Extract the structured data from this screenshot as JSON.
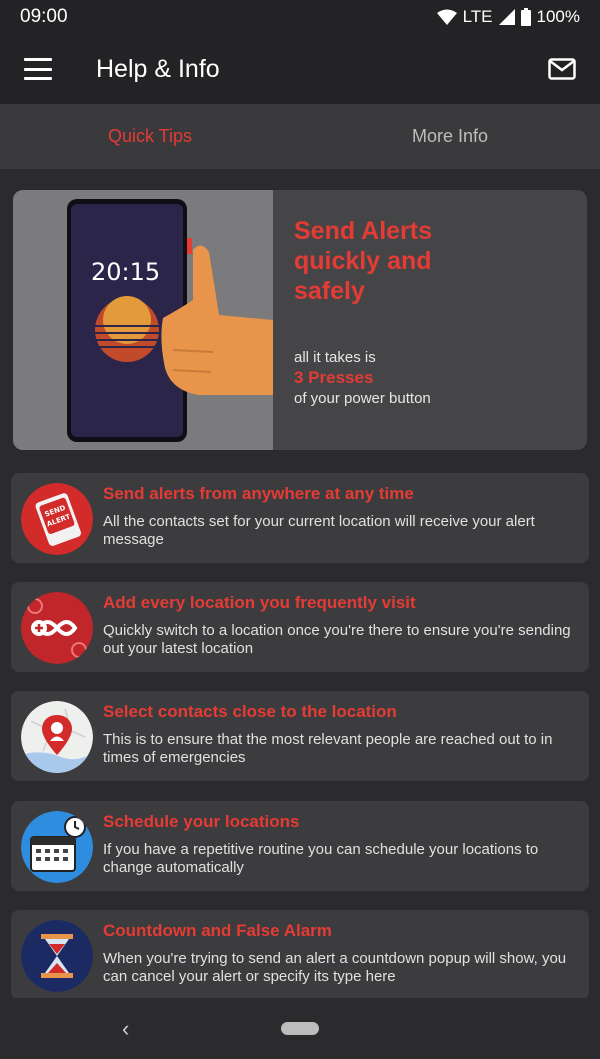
{
  "status_bar": {
    "time": "09:00",
    "network": "LTE",
    "battery": "100%"
  },
  "app_bar": {
    "title": "Help & Info",
    "menu_icon": "menu-icon",
    "mail_icon": "mail-icon"
  },
  "tabs": [
    {
      "label": "Quick Tips",
      "active": true
    },
    {
      "label": "More Info",
      "active": false
    }
  ],
  "hero": {
    "phone_clock": "20:15",
    "heading": "Send Alerts quickly and safely",
    "sub": "all it takes is",
    "presses": "3 Presses",
    "power": "of your power button"
  },
  "tips": [
    {
      "title": "Send alerts from anywhere at any time",
      "desc": "All the contacts set for your current location will receive your alert message",
      "icon": "send-alert-icon",
      "badge": "SEND ALERT"
    },
    {
      "title": "Add every location you frequently visit",
      "desc": "Quickly switch to a location once you're there to ensure you're sending out your latest location",
      "icon": "add-location-icon"
    },
    {
      "title": "Select contacts close to the location",
      "desc": "This is to ensure that the most relevant people are reached out to in times of emergencies",
      "icon": "map-pin-icon"
    },
    {
      "title": "Schedule your locations",
      "desc": "If you have a repetitive routine you can schedule your locations to change automatically",
      "icon": "calendar-clock-icon"
    },
    {
      "title": "Countdown and False Alarm",
      "desc": "When you're trying to send an alert a countdown popup will show, you can cancel your alert or specify its type here",
      "icon": "hourglass-icon"
    }
  ],
  "colors": {
    "accent": "#e53b35",
    "background": "#2b2b2d",
    "card": "#3c3c3e"
  }
}
